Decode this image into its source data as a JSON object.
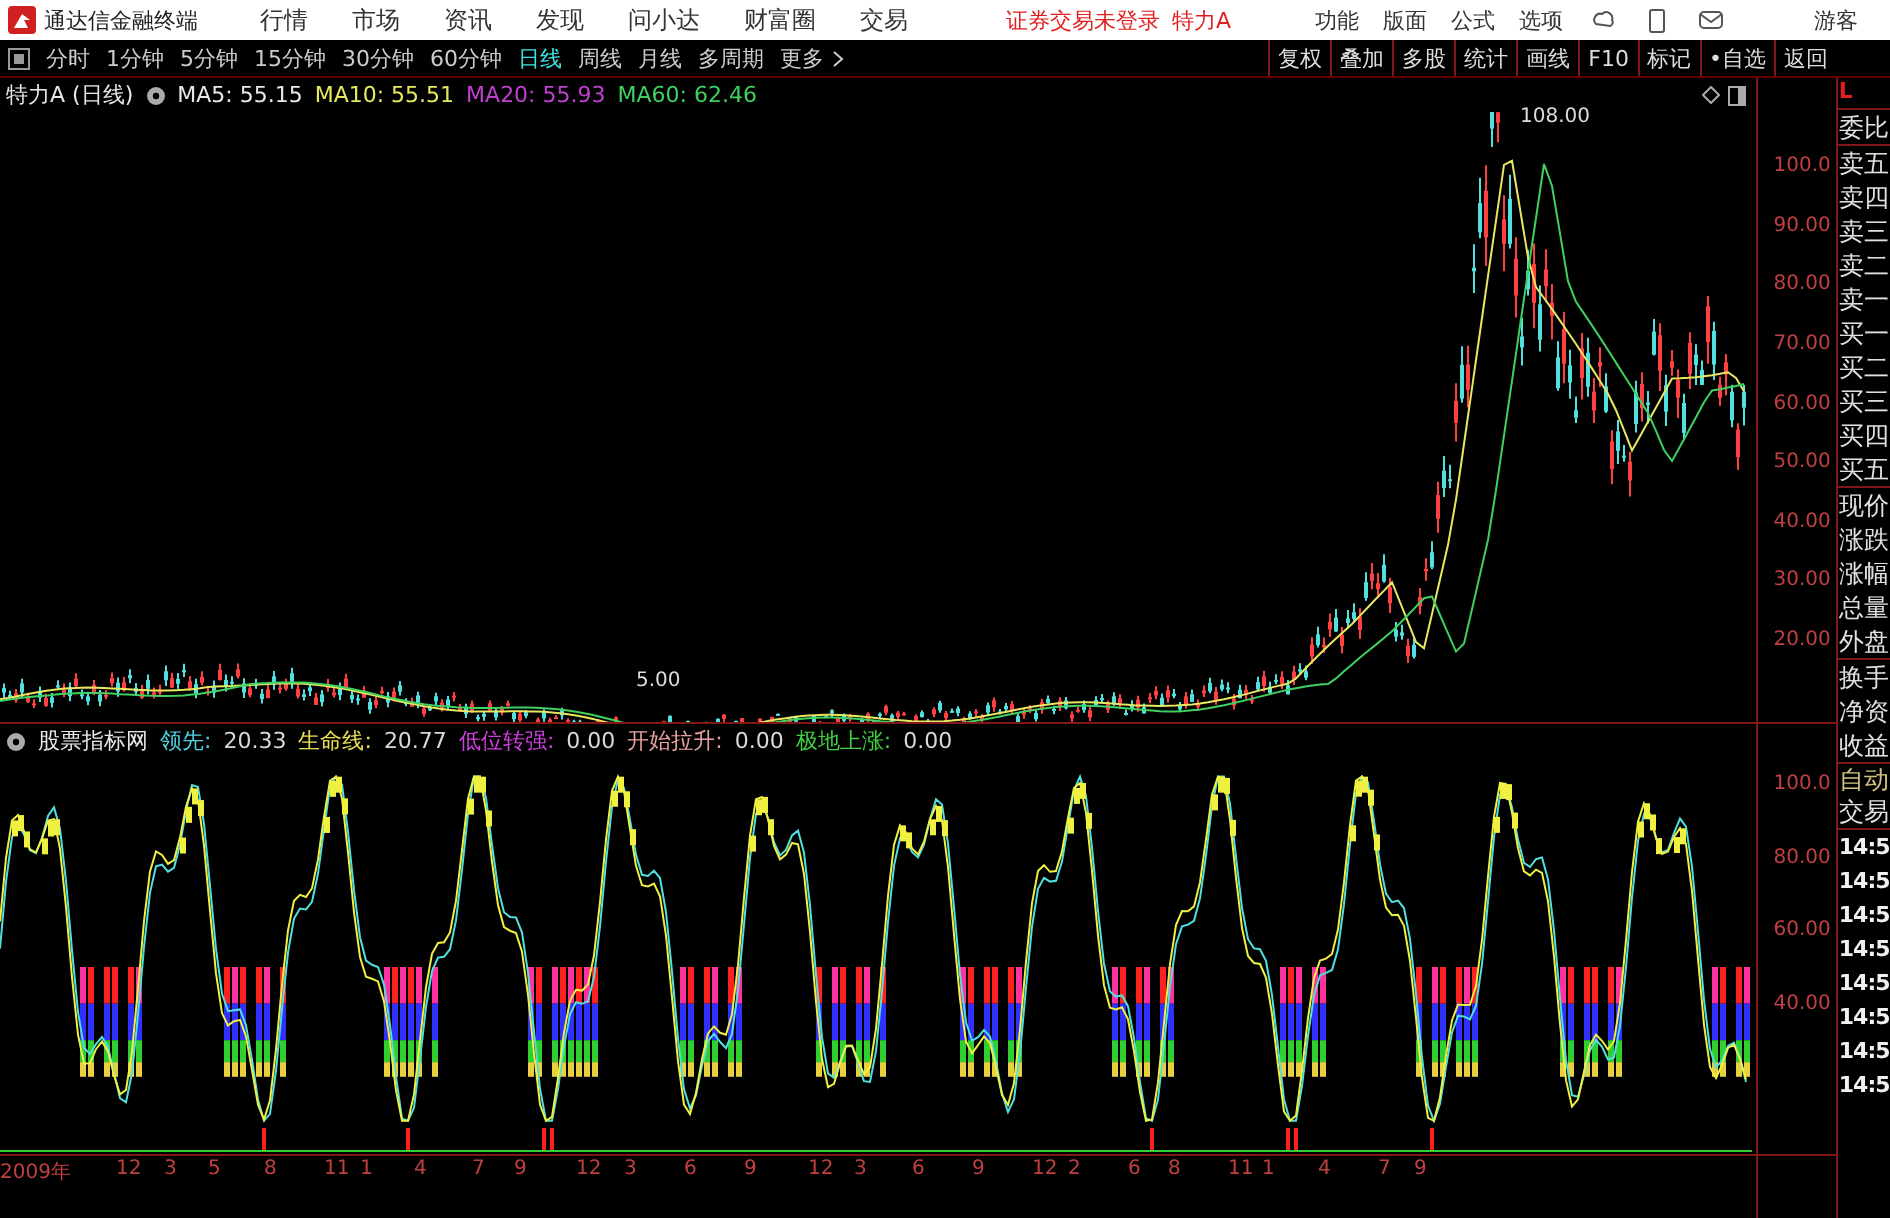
{
  "title_bar": {
    "app_name": "通达信金融终端",
    "menus": [
      "行情",
      "市场",
      "资讯",
      "发现",
      "问小达",
      "财富圈",
      "交易"
    ],
    "login_status": "证券交易未登录",
    "stock_name": "特力A",
    "right_menus": [
      "功能",
      "版面",
      "公式",
      "选项"
    ],
    "user": "游客"
  },
  "toolbar": {
    "periods": [
      {
        "label": "分时",
        "selected": false
      },
      {
        "label": "1分钟",
        "selected": false
      },
      {
        "label": "5分钟",
        "selected": false
      },
      {
        "label": "15分钟",
        "selected": false
      },
      {
        "label": "30分钟",
        "selected": false
      },
      {
        "label": "60分钟",
        "selected": false
      },
      {
        "label": "日线",
        "selected": true
      },
      {
        "label": "周线",
        "selected": false
      },
      {
        "label": "月线",
        "selected": false
      },
      {
        "label": "多周期",
        "selected": false
      }
    ],
    "more": "更多",
    "actions": [
      "复权",
      "叠加",
      "多股",
      "统计",
      "画线",
      "F10",
      "标记",
      "•自选",
      "返回"
    ]
  },
  "price_chart": {
    "title": "特力A (日线)",
    "legend": [
      {
        "text": "MA5: 55.15",
        "color": "#e8e8e8"
      },
      {
        "text": "MA10: 55.51",
        "color": "#e8e860"
      },
      {
        "text": "MA20: 55.93",
        "color": "#c040d0"
      },
      {
        "text": "MA60: 62.46",
        "color": "#40d060"
      }
    ],
    "high_label": "108.00",
    "low_label": "5.00",
    "y_ticks": [
      "100.0",
      "90.00",
      "80.00",
      "70.00",
      "60.00",
      "50.00",
      "40.00",
      "30.00",
      "20.00"
    ]
  },
  "indicator_chart": {
    "title": "股票指标网",
    "legend": [
      {
        "label": "领先:",
        "value": "20.33",
        "color": "#50d0e0"
      },
      {
        "label": "生命线:",
        "value": "20.77",
        "color": "#e8e050"
      },
      {
        "label": "低位转强:",
        "value": "0.00",
        "color": "#d040e0"
      },
      {
        "label": "开始拉升:",
        "value": "0.00",
        "color": "#e8a0a0"
      },
      {
        "label": "极地上涨:",
        "value": "0.00",
        "color": "#40d040"
      }
    ],
    "y_ticks": [
      "100.0",
      "80.00",
      "60.00",
      "40.00"
    ]
  },
  "date_axis": [
    "2009年",
    "12",
    "3",
    "5",
    "8",
    "11",
    "1",
    "4",
    "7",
    "9",
    "12",
    "3",
    "6",
    "9",
    "12",
    "3",
    "6",
    "9",
    "12",
    "2",
    "6",
    "8",
    "11",
    "1",
    "4",
    "7",
    "9"
  ],
  "quote_panel": {
    "header": "L",
    "rows": [
      "委比",
      "卖五",
      "卖四",
      "卖三",
      "卖二",
      "卖一",
      "买一",
      "买二",
      "买三",
      "买四",
      "买五",
      "现价",
      "涨跌",
      "涨幅",
      "总量",
      "外盘",
      "换手",
      "净资",
      "收益"
    ],
    "trade_rows": [
      "自动",
      "交易"
    ],
    "times": [
      "14:5",
      "14:5",
      "14:5",
      "14:5",
      "14:5",
      "14:5",
      "14:5",
      "14:5"
    ]
  }
}
